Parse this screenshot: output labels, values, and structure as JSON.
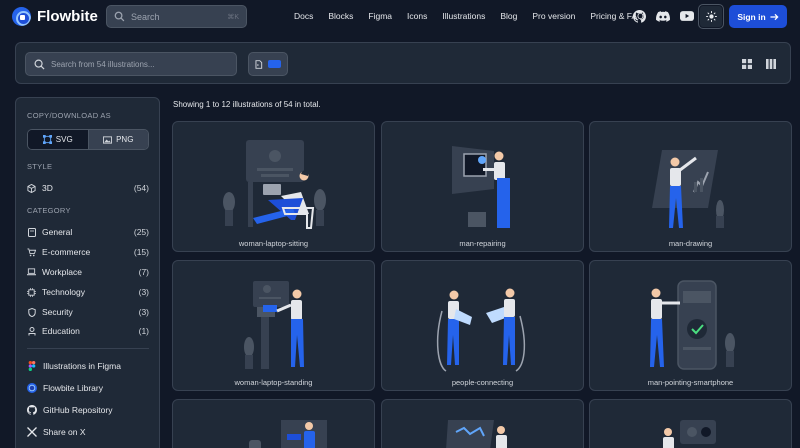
{
  "brand": {
    "name": "Flowbite"
  },
  "search": {
    "placeholder": "Search",
    "shortcut": "⌘K"
  },
  "nav": {
    "links": [
      "Docs",
      "Blocks",
      "Figma",
      "Icons",
      "Illustrations",
      "Blog",
      "Pro version",
      "Pricing & FAQ"
    ],
    "icons": [
      "github-icon",
      "discord-icon",
      "youtube-icon"
    ],
    "theme_icon": "sun-icon",
    "signin_label": "Sign in"
  },
  "toolbar": {
    "search_placeholder": "Search from 54 illustrations...",
    "view_icons": [
      "grid-view-icon",
      "columns-view-icon"
    ]
  },
  "sidebar": {
    "copy_heading": "COPY/DOWNLOAD AS",
    "formats": [
      {
        "label": "SVG",
        "selected": true
      },
      {
        "label": "PNG",
        "selected": false
      }
    ],
    "style_heading": "STYLE",
    "styles": [
      {
        "label": "3D",
        "count": "(54)",
        "icon": "cube-icon"
      }
    ],
    "category_heading": "CATEGORY",
    "categories": [
      {
        "label": "General",
        "count": "(25)",
        "icon": "book-icon"
      },
      {
        "label": "E-commerce",
        "count": "(15)",
        "icon": "cart-icon"
      },
      {
        "label": "Workplace",
        "count": "(7)",
        "icon": "laptop-icon"
      },
      {
        "label": "Technology",
        "count": "(3)",
        "icon": "chip-icon"
      },
      {
        "label": "Security",
        "count": "(3)",
        "icon": "shield-icon"
      },
      {
        "label": "Education",
        "count": "(1)",
        "icon": "graduation-icon"
      }
    ],
    "links": [
      {
        "label": "Illustrations in Figma",
        "icon": "figma-icon"
      },
      {
        "label": "Flowbite Library",
        "icon": "flowbite-icon"
      },
      {
        "label": "GitHub Repository",
        "icon": "github-icon"
      },
      {
        "label": "Share on X",
        "icon": "x-icon"
      }
    ]
  },
  "main": {
    "showing_text": "Showing 1 to 12 illustrations of 54 in total.",
    "cards": [
      {
        "name": "woman-laptop-sitting"
      },
      {
        "name": "man-repairing"
      },
      {
        "name": "man-drawing"
      },
      {
        "name": "woman-laptop-standing"
      },
      {
        "name": "people-connecting"
      },
      {
        "name": "man-pointing-smartphone"
      },
      {
        "name": ""
      },
      {
        "name": ""
      },
      {
        "name": ""
      }
    ]
  },
  "colors": {
    "accent": "#1d4ed8",
    "figure_blue": "#2563eb",
    "background": "#111827",
    "panel": "#1f2937"
  }
}
